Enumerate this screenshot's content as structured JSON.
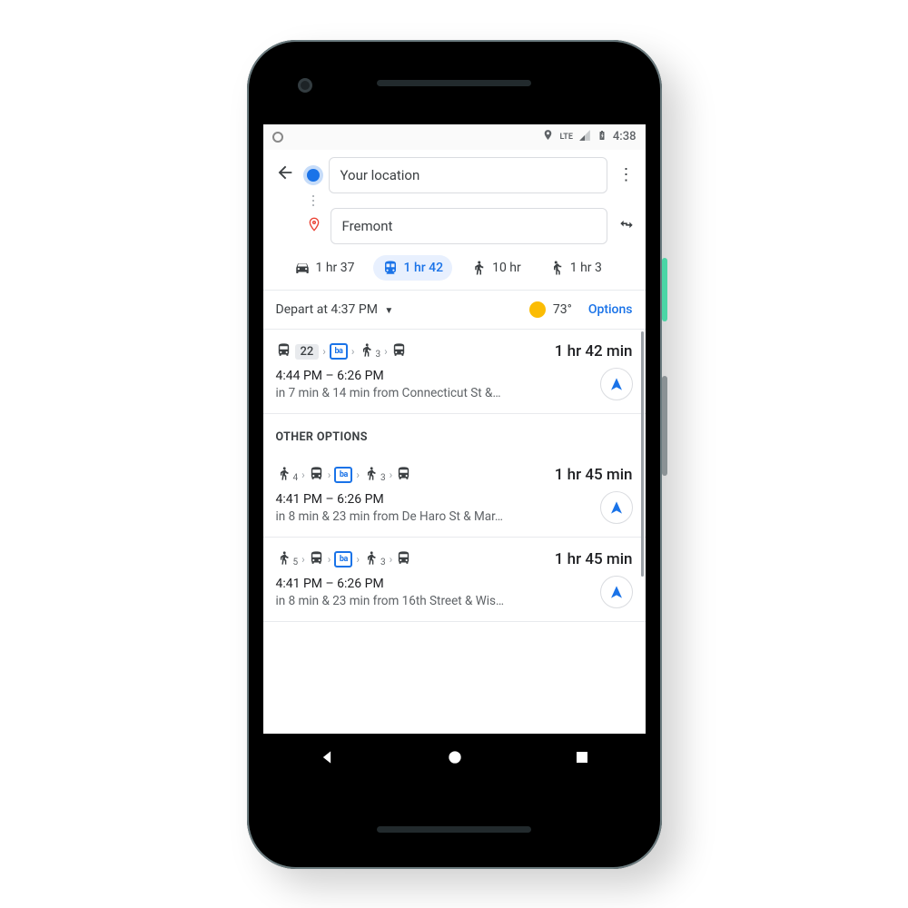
{
  "statusbar": {
    "lte": "LTE",
    "time": "4:38"
  },
  "header": {
    "origin": "Your location",
    "destination": "Fremont"
  },
  "modes": {
    "car": "1 hr 37",
    "transit": "1 hr 42",
    "walk": "10 hr",
    "ride": "1 hr 3"
  },
  "depart": {
    "label": "Depart at 4:37 PM",
    "temp": "73°",
    "options": "Options"
  },
  "section_other": "OTHER OPTIONS",
  "routes": [
    {
      "bus_label": "22",
      "walk_sub": "3",
      "duration": "1 hr 42 min",
      "times": "4:44 PM – 6:26 PM",
      "detail": "in 7 min & 14 min from Connecticut St &…"
    },
    {
      "walk_pre_sub": "4",
      "walk_sub": "3",
      "duration": "1 hr 45 min",
      "times": "4:41 PM – 6:26 PM",
      "detail": "in 8 min & 23 min from De Haro St & Mar…"
    },
    {
      "walk_pre_sub": "5",
      "walk_sub": "3",
      "duration": "1 hr 45 min",
      "times": "4:41 PM – 6:26 PM",
      "detail": "in 8 min & 23 min from 16th Street & Wis…"
    }
  ]
}
